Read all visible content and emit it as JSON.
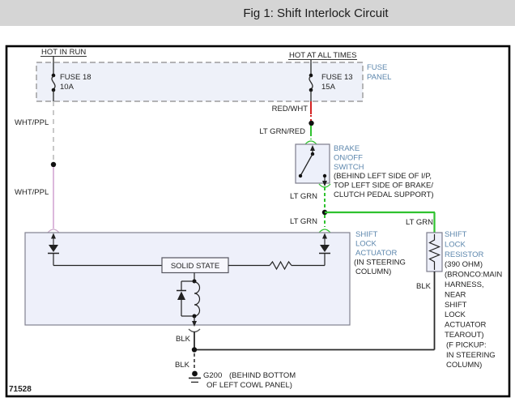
{
  "title": "Fig 1: Shift Interlock Circuit",
  "figure_number": "71528",
  "colors": {
    "label_blue": "#5d87ad",
    "wire_green": "#2fc22f",
    "wire_red": "#d42222",
    "wire_wht_ppl": "#dcb8dc",
    "wire_black": "#2a2a2a",
    "titlebar_gray": "#d5d5d5"
  },
  "fuse_panel": {
    "left_feed": "HOT IN RUN",
    "right_feed": "HOT AT ALL TIMES",
    "name_line1": "FUSE",
    "name_line2": "PANEL",
    "fuse_left_name": "FUSE 18",
    "fuse_left_rating": "10A",
    "fuse_right_name": "FUSE 13",
    "fuse_right_rating": "15A"
  },
  "wires": {
    "wht_ppl_upper": "WHT/PPL",
    "wht_ppl_lower": "WHT/PPL",
    "red_wht": "RED/WHT",
    "lt_grn_red": "LT GRN/RED",
    "lt_grn_below_switch": "LT GRN",
    "lt_grn_to_actuator": "LT GRN",
    "lt_grn_to_resistor": "LT GRN",
    "blk_actuator_out": "BLK",
    "blk_resistor_out": "BLK",
    "blk_to_ground": "BLK"
  },
  "brake_switch": {
    "name_lines": [
      "BRAKE",
      "ON/OFF",
      "SWITCH"
    ],
    "location_lines": [
      "(BEHIND LEFT SIDE OF I/P,",
      "TOP LEFT SIDE OF BRAKE/",
      "CLUTCH PEDAL SUPPORT)"
    ]
  },
  "actuator": {
    "name_lines": [
      "SHIFT",
      "LOCK",
      "ACTUATOR"
    ],
    "location_lines": [
      "(IN STEERING",
      "COLUMN)"
    ],
    "solid_state_label": "SOLID STATE"
  },
  "resistor": {
    "name_lines": [
      "SHIFT",
      "LOCK",
      "RESISTOR"
    ],
    "detail_lines": [
      "(390 OHM)",
      "(BRONCO:MAIN",
      "HARNESS,",
      "NEAR",
      "SHIFT",
      "LOCK",
      "ACTUATOR",
      "TEAROUT)",
      "(F PICKUP:",
      "IN STEERING",
      "COLUMN)"
    ]
  },
  "ground": {
    "name": "G200",
    "location_line1": "(BEHIND BOTTOM",
    "location_line2": "OF LEFT COWL PANEL)"
  }
}
